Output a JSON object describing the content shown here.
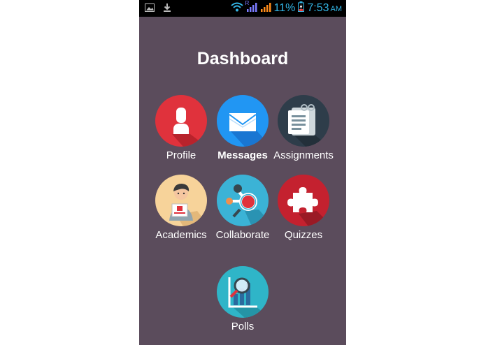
{
  "status_bar": {
    "battery_percent": "11%",
    "time": "7:53",
    "ampm": "AM",
    "network_indicator": "R",
    "icons": [
      "image-notification-icon",
      "download-icon",
      "wifi-icon",
      "signal-icon",
      "signal-icon",
      "battery-charging-icon"
    ]
  },
  "dashboard": {
    "title": "Dashboard",
    "tiles": [
      {
        "label": "Profile",
        "icon": "profile-icon",
        "color": "#e0323c"
      },
      {
        "label": "Messages",
        "icon": "envelope-icon",
        "color": "#2196f3"
      },
      {
        "label": "Assignments",
        "icon": "clipboard-icon",
        "color": "#2e3d4a"
      },
      {
        "label": "Academics",
        "icon": "student-avatar-icon",
        "color": "#f7d39a"
      },
      {
        "label": "Collaborate",
        "icon": "network-icon",
        "color": "#3bb3d6"
      },
      {
        "label": "Quizzes",
        "icon": "puzzle-icon",
        "color": "#c4212f"
      },
      {
        "label": "Polls",
        "icon": "chart-magnifier-icon",
        "color": "#2fb5c8"
      }
    ]
  }
}
